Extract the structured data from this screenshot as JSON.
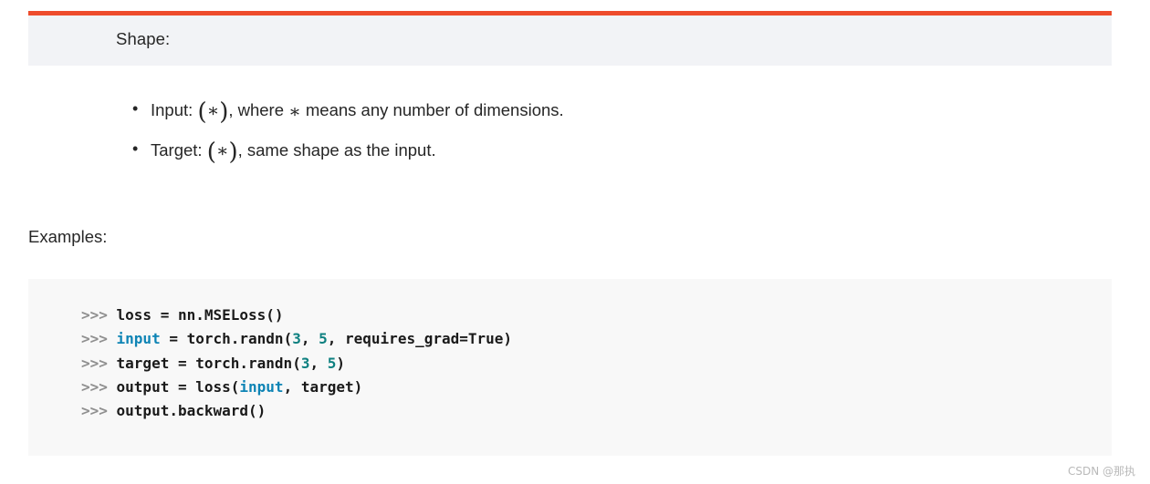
{
  "shape_section": {
    "accent_color": "#ee4c2c",
    "panel_bg": "#f2f3f6",
    "heading": "Shape:",
    "items": [
      {
        "label": "Input:",
        "symbol_open": "(",
        "symbol_star": "∗",
        "symbol_close": ")",
        "rest": ", where ∗ means any number of dimensions.",
        "rest_before_star": ", where ",
        "rest_after_star": " means any number of dimensions."
      },
      {
        "label": "Target:",
        "symbol_open": "(",
        "symbol_star": "∗",
        "symbol_close": ")",
        "rest": ", same shape as the input.",
        "rest_before_star": ", same shape as the input.",
        "rest_after_star": ""
      }
    ],
    "bullet_glyph": "•"
  },
  "examples_section": {
    "label": "Examples:",
    "code_bg": "#f8f8f8",
    "prompt": ">>> ",
    "colors": {
      "prompt": "#8f8f8f",
      "name": "#0e84b5",
      "number": "#0e8080",
      "plain": "#1a1a1a"
    },
    "lines": [
      {
        "prompt": ">>> ",
        "tokens": [
          {
            "text": "loss = nn.MSELoss()",
            "type": "plain"
          }
        ]
      },
      {
        "prompt": ">>> ",
        "tokens": [
          {
            "text": "input",
            "type": "name"
          },
          {
            "text": " = torch.randn(",
            "type": "plain"
          },
          {
            "text": "3",
            "type": "num"
          },
          {
            "text": ", ",
            "type": "plain"
          },
          {
            "text": "5",
            "type": "num"
          },
          {
            "text": ", requires_grad=True)",
            "type": "plain"
          }
        ]
      },
      {
        "prompt": ">>> ",
        "tokens": [
          {
            "text": "target = torch.randn(",
            "type": "plain"
          },
          {
            "text": "3",
            "type": "num"
          },
          {
            "text": ", ",
            "type": "plain"
          },
          {
            "text": "5",
            "type": "num"
          },
          {
            "text": ")",
            "type": "plain"
          }
        ]
      },
      {
        "prompt": ">>> ",
        "tokens": [
          {
            "text": "output = loss(",
            "type": "plain"
          },
          {
            "text": "input",
            "type": "name"
          },
          {
            "text": ", target)",
            "type": "plain"
          }
        ]
      },
      {
        "prompt": ">>> ",
        "tokens": [
          {
            "text": "output.backward()",
            "type": "plain"
          }
        ]
      }
    ]
  },
  "watermark": {
    "text": "CSDN @那执"
  }
}
